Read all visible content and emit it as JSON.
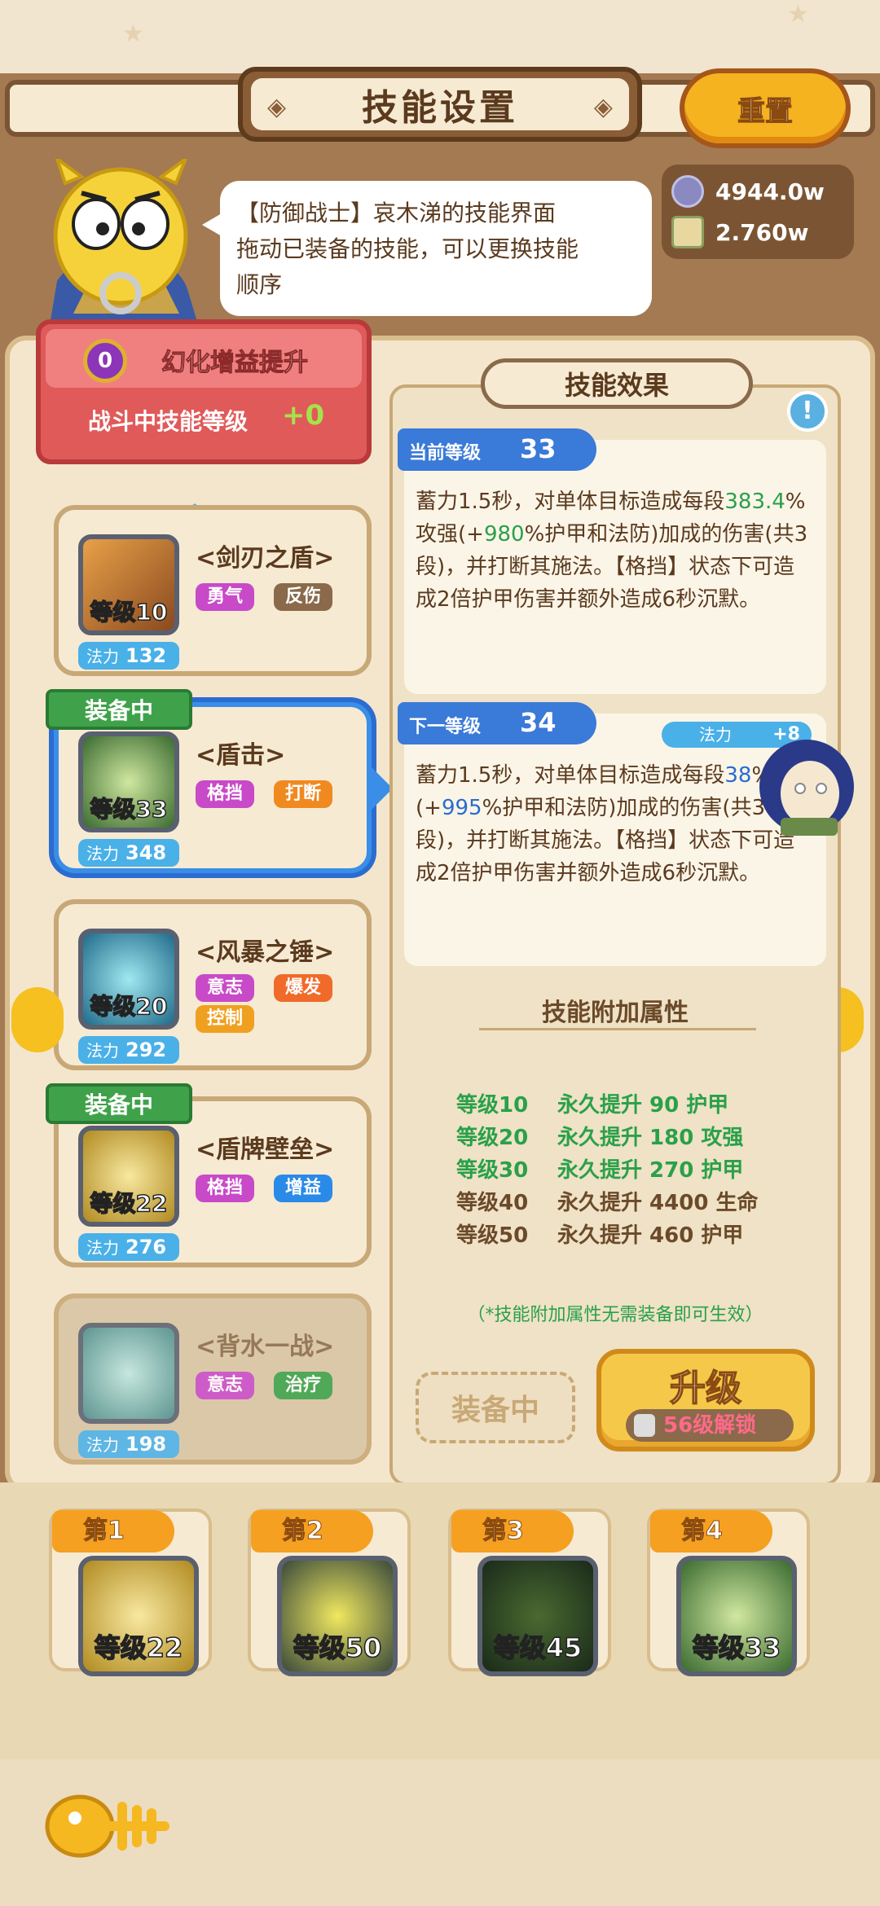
{
  "header": {
    "title": "技能设置",
    "reset_label": "重置"
  },
  "speech": {
    "line1": "【防御战士】哀木涕的技能界面",
    "line2": "拖动已装备的技能，可以更换技能",
    "line3": "顺序"
  },
  "currency": [
    {
      "icon": "swirl-coin-icon",
      "value": "4944.0w"
    },
    {
      "icon": "scroll-icon",
      "value": "2.760w"
    }
  ],
  "boost": {
    "badge": "0",
    "title": "幻化增益提升",
    "level_label": "战斗中技能等级",
    "level_value": "+0"
  },
  "skills": [
    {
      "name": "<剑刃之盾>",
      "level": "等级10",
      "tags": [
        "勇气",
        "反伤"
      ],
      "mp_label": "法力",
      "mp": "132",
      "equipped": false
    },
    {
      "name": "<盾击>",
      "level": "等级33",
      "tags": [
        "格挡",
        "打断"
      ],
      "mp_label": "法力",
      "mp": "348",
      "equipped": true,
      "equip_label": "装备中"
    },
    {
      "name": "<风暴之锤>",
      "level": "等级20",
      "tags": [
        "意志",
        "爆发",
        "控制"
      ],
      "mp_label": "法力",
      "mp": "292",
      "equipped": false
    },
    {
      "name": "<盾牌壁垒>",
      "level": "等级22",
      "tags": [
        "格挡",
        "增益"
      ],
      "mp_label": "法力",
      "mp": "276",
      "equipped": true,
      "equip_label": "装备中"
    },
    {
      "name": "<背水一战>",
      "level": "",
      "tags": [
        "意志",
        "治疗"
      ],
      "mp_label": "法力",
      "mp": "198",
      "equipped": false
    }
  ],
  "effect": {
    "title": "技能效果",
    "current": {
      "label": "当前等级",
      "level": "33",
      "desc_a": "蓄力1.5秒，对单体目标造成每段",
      "val_a": "383.4",
      "desc_b": "%攻强(+",
      "val_b": "980",
      "desc_c": "%护甲和法防)加成的伤害(共3段)，并打断其施法。【格挡】状态下可造成2倍护甲伤害并额外造成6秒沉默。"
    },
    "next": {
      "label": "下一等级",
      "level": "34",
      "mp_label": "法力",
      "mp_plus": "+8",
      "desc_a": "蓄力1.5秒，对单体目标造成每段",
      "val_a": "38",
      "desc_b": "%攻强(+",
      "val_b": "995",
      "desc_c": "%护甲和法防)加成的伤害(共3段)，并打断其施法。【格挡】状态下可造成2倍护甲伤害并额外造成6秒沉默。"
    }
  },
  "attributes": {
    "title": "技能附加属性",
    "rows": [
      {
        "level": "等级10",
        "text": "永久提升 90 护甲",
        "active": true
      },
      {
        "level": "等级20",
        "text": "永久提升 180 攻强",
        "active": true
      },
      {
        "level": "等级30",
        "text": "永久提升 270 护甲",
        "active": true
      },
      {
        "level": "等级40",
        "text": "永久提升 4400 生命",
        "active": false
      },
      {
        "level": "等级50",
        "text": "永久提升 460 护甲",
        "active": false
      }
    ],
    "note": "（*技能附加属性无需装备即可生效）"
  },
  "actions": {
    "equip_label": "装备中",
    "upgrade_label": "升级",
    "unlock_label": "56级解锁"
  },
  "slots": [
    {
      "label": "第1",
      "level": "等级22"
    },
    {
      "label": "第2",
      "level": "等级50"
    },
    {
      "label": "第3",
      "level": "等级45"
    },
    {
      "label": "第4",
      "level": "等级33"
    }
  ],
  "colors": {
    "active_attr": "#2aa04a",
    "inactive_attr": "#6b4a2a",
    "accent_blue": "#3a7ad8"
  }
}
